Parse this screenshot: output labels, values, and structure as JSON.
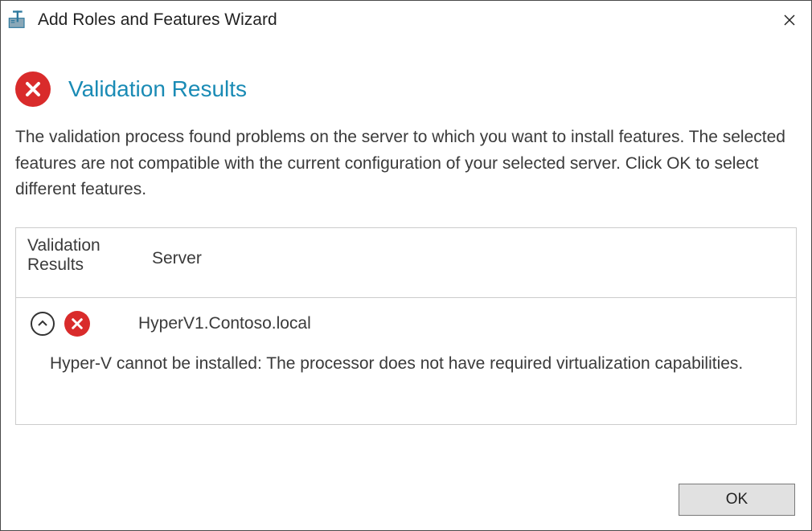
{
  "window": {
    "title": "Add Roles and Features Wizard"
  },
  "header": {
    "title": "Validation Results"
  },
  "description": "The validation process found problems on the server to which you want to install features. The selected features are not compatible with the current configuration of your selected server.  Click OK to select different features.",
  "table": {
    "columns": {
      "results": "Validation Results",
      "server": "Server"
    },
    "rows": [
      {
        "server": "HyperV1.Contoso.local",
        "message": "Hyper-V cannot be installed: The processor does not have required virtualization capabilities."
      }
    ]
  },
  "buttons": {
    "ok": "OK"
  }
}
